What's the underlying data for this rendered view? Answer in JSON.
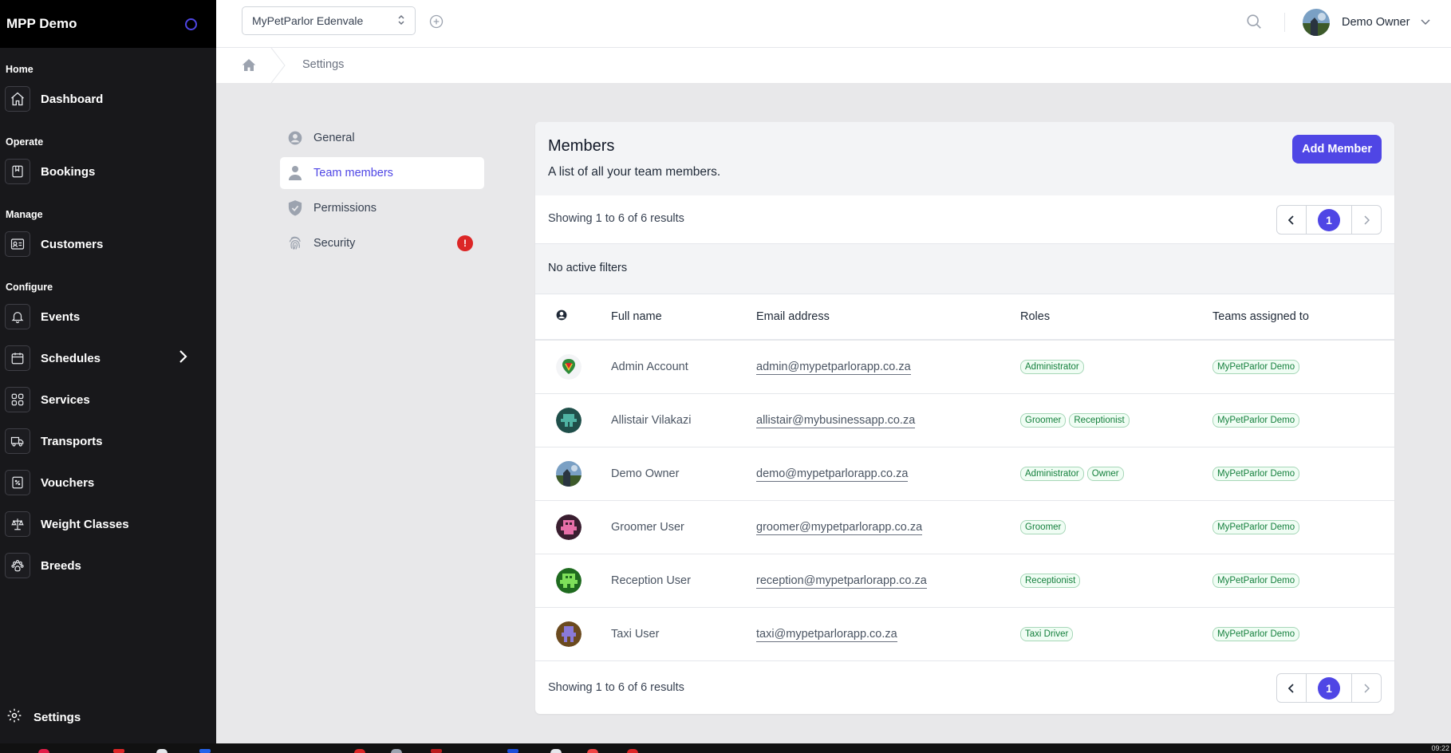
{
  "sidebar": {
    "title": "MPP Demo",
    "sections": {
      "home": "Home",
      "operate": "Operate",
      "manage": "Manage",
      "configure": "Configure"
    },
    "items": {
      "dashboard": "Dashboard",
      "bookings": "Bookings",
      "customers": "Customers",
      "events": "Events",
      "schedules": "Schedules",
      "services": "Services",
      "transports": "Transports",
      "vouchers": "Vouchers",
      "weight_classes": "Weight Classes",
      "breeds": "Breeds"
    },
    "settings": "Settings"
  },
  "topbar": {
    "location": "MyPetParlor Edenvale",
    "user_name": "Demo Owner"
  },
  "breadcrumb": {
    "current": "Settings"
  },
  "settings_nav": {
    "general": "General",
    "team_members": "Team members",
    "permissions": "Permissions",
    "security": "Security",
    "security_alert": "!"
  },
  "members": {
    "title": "Members",
    "subtitle": "A list of all your team members.",
    "add_button": "Add Member",
    "showing": "Showing 1 to 6 of 6 results",
    "current_page": "1",
    "filters": "No active filters",
    "columns": {
      "full_name": "Full name",
      "email": "Email address",
      "roles": "Roles",
      "teams": "Teams assigned to"
    },
    "rows": [
      {
        "name": "Admin Account",
        "email": "admin@mypetparlorapp.co.za",
        "roles": [
          "Administrator"
        ],
        "team": "MyPetParlor Demo"
      },
      {
        "name": "Allistair Vilakazi",
        "email": "allistair@mybusinessapp.co.za",
        "roles": [
          "Groomer",
          "Receptionist"
        ],
        "team": "MyPetParlor Demo"
      },
      {
        "name": "Demo Owner",
        "email": "demo@mypetparlorapp.co.za",
        "roles": [
          "Administrator",
          "Owner"
        ],
        "team": "MyPetParlor Demo"
      },
      {
        "name": "Groomer User",
        "email": "groomer@mypetparlorapp.co.za",
        "roles": [
          "Groomer"
        ],
        "team": "MyPetParlor Demo"
      },
      {
        "name": "Reception User",
        "email": "reception@mypetparlorapp.co.za",
        "roles": [
          "Receptionist"
        ],
        "team": "MyPetParlor Demo"
      },
      {
        "name": "Taxi User",
        "email": "taxi@mypetparlorapp.co.za",
        "roles": [
          "Taxi Driver"
        ],
        "team": "MyPetParlor Demo"
      }
    ]
  },
  "taskbar": {
    "clock": "09:22"
  },
  "colors": {
    "accent": "#4f46e5",
    "sidebar_bg": "#18181b",
    "badge_green": "#15803d",
    "alert_red": "#dc2626"
  }
}
